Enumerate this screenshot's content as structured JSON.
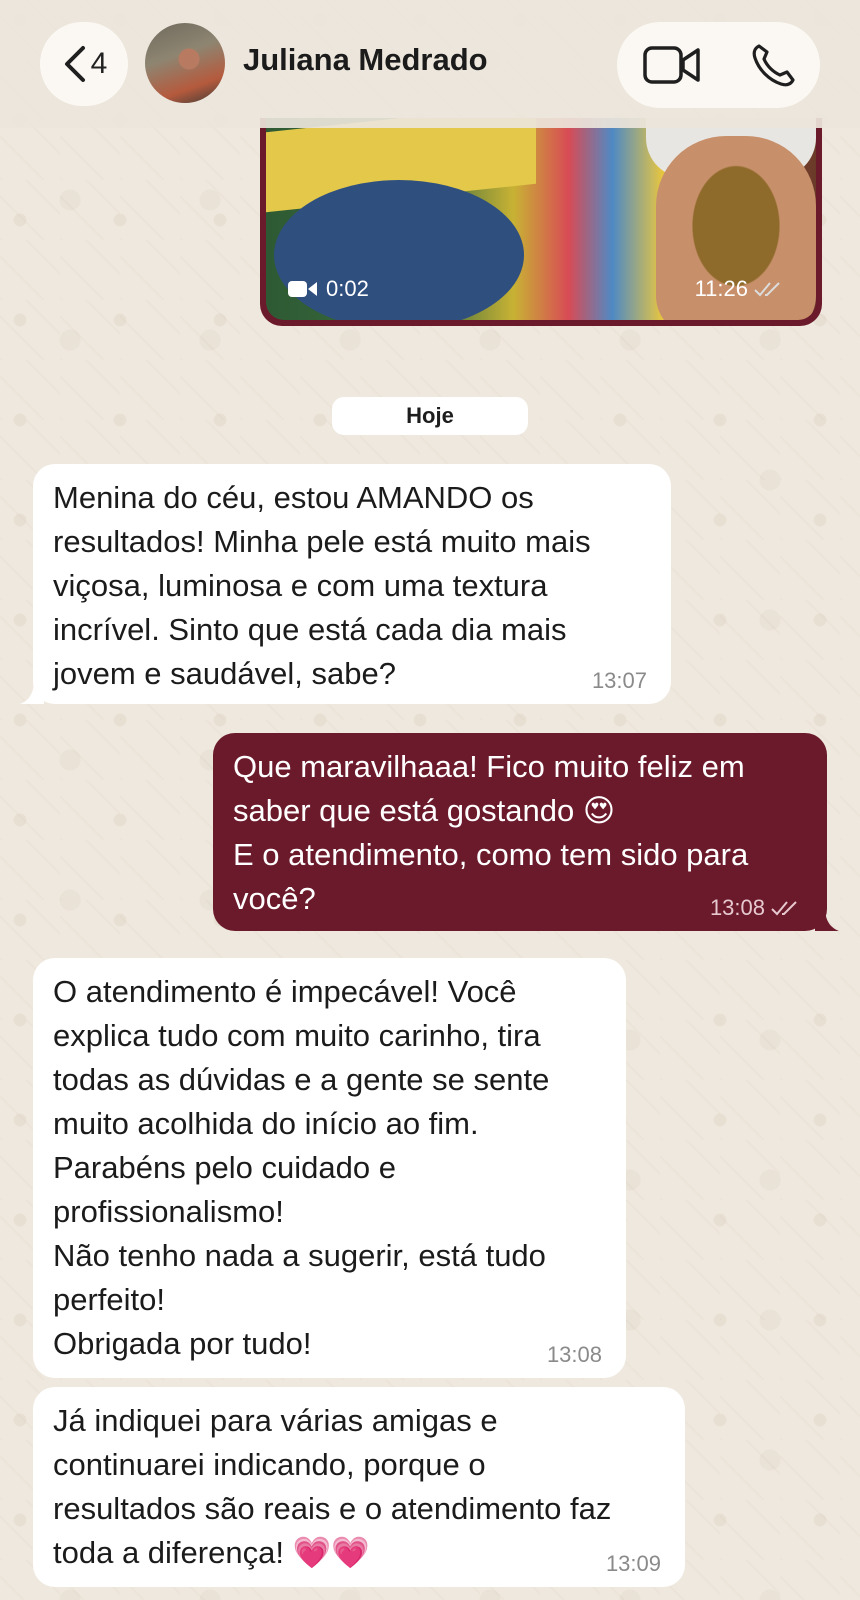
{
  "header": {
    "back_count": "4",
    "contact_name": "Juliana Medrado",
    "icons": {
      "back": "chevron-left-icon",
      "video": "video-camera-icon",
      "phone": "phone-icon"
    }
  },
  "video_message": {
    "duration": "0:02",
    "time": "11:26",
    "status": "read"
  },
  "date_separator": "Hoje",
  "messages": [
    {
      "direction": "incoming",
      "text": "Menina do céu, estou AMANDO os\nresultados! Minha pele está muito mais\nviçosa, luminosa e com uma textura\nincrível. Sinto que está cada dia mais\njovem e saudável, sabe?",
      "time": "13:07"
    },
    {
      "direction": "outgoing",
      "text": "Que maravilhaaa! Fico muito feliz em\nsaber que está gostando 😍\nE o atendimento, como tem sido para\nvocê?",
      "time": "13:08",
      "status": "read"
    },
    {
      "direction": "incoming",
      "text": "O atendimento é impecável! Você\nexplica tudo com muito carinho, tira\ntodas as dúvidas e a gente se sente\nmuito acolhida do início ao fim.\nParabéns pelo cuidado e\nprofissionalismo!\nNão tenho nada a sugerir, está tudo\nperfeito!\nObrigada por tudo!",
      "time": "13:08"
    },
    {
      "direction": "incoming",
      "text": "Já indiquei para várias amigas e\ncontinuarei indicando, porque o\nresultados são reais e o atendimento faz\ntoda a diferença! 💗💗",
      "time": "13:09"
    }
  ],
  "colors": {
    "outgoing_bubble": "#6b1a2b",
    "incoming_bubble": "#ffffff",
    "wallpaper": "#efe8de"
  }
}
